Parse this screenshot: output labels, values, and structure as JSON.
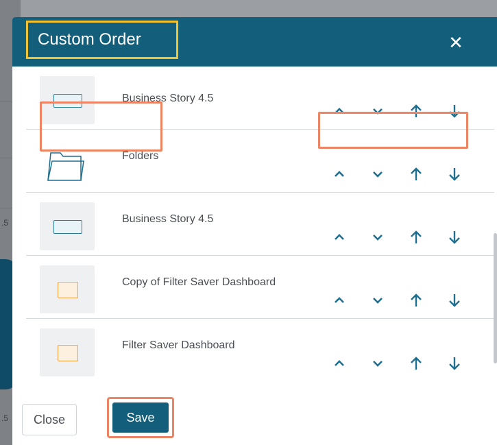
{
  "background": {
    "side_labels": [
      ".5",
      ".5"
    ]
  },
  "modal": {
    "title": "Custom Order",
    "close_glyph": "✕"
  },
  "items": [
    {
      "name": "Business Story 4.5",
      "thumb_icon": "business-story-thumbnail"
    },
    {
      "name": "Folders",
      "thumb_icon": "folder-icon"
    },
    {
      "name": "Business Story 4.5",
      "thumb_icon": "business-story-thumbnail"
    },
    {
      "name": "Copy of Filter Saver Dashboard",
      "thumb_icon": "dashboard-thumbnail"
    },
    {
      "name": "Filter Saver Dashboard",
      "thumb_icon": "dashboard-thumbnail"
    }
  ],
  "controls": [
    "move-up-one",
    "move-down-one",
    "move-to-top",
    "move-to-bottom"
  ],
  "footer": {
    "close_label": "Close",
    "save_label": "Save"
  },
  "colors": {
    "header": "#135f7b",
    "title_highlight": "#f2c230",
    "annotation": "#ec8563",
    "arrow": "#1f6f8f"
  }
}
